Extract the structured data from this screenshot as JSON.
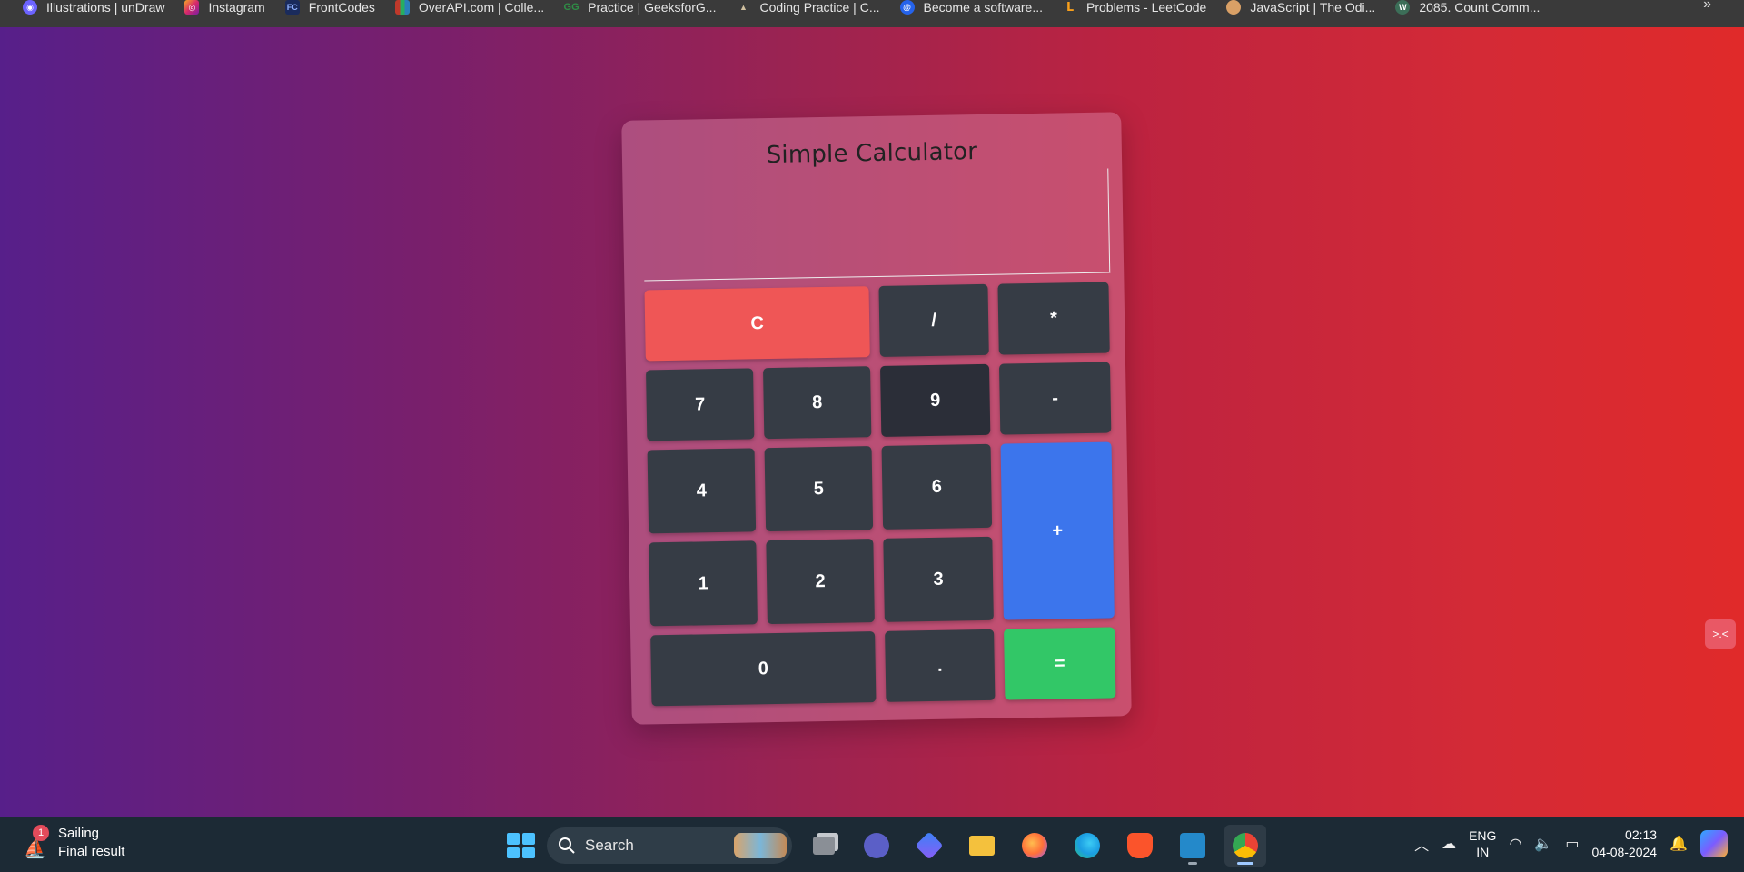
{
  "bookmarks": [
    {
      "label": "Illustrations | unDraw",
      "icon": "undraw-icon",
      "color": "#6c63ff"
    },
    {
      "label": "Instagram",
      "icon": "instagram-icon",
      "color": "#d6286b"
    },
    {
      "label": "FrontCodes",
      "icon": "frontcodes-icon",
      "color": "#1a2b5c"
    },
    {
      "label": "OverAPI.com | Colle...",
      "icon": "overapi-icon",
      "color": "#c0392b"
    },
    {
      "label": "Practice | GeeksforG...",
      "icon": "geeksforgeeks-icon",
      "color": "#2f8d46"
    },
    {
      "label": "Coding Practice | C...",
      "icon": "codechef-icon",
      "color": "#5b4638"
    },
    {
      "label": "Become a software...",
      "icon": "scaler-icon",
      "color": "#2563eb"
    },
    {
      "label": "Problems - LeetCode",
      "icon": "leetcode-icon",
      "color": "#f89f1b"
    },
    {
      "label": "JavaScript | The Odi...",
      "icon": "odin-icon",
      "color": "#d9a066"
    },
    {
      "label": "2085. Count Comm...",
      "icon": "leetcode-w-icon",
      "color": "#3c6e58"
    }
  ],
  "bookmarks_more": "»",
  "calculator": {
    "title": "Simple Calculator",
    "display_value": "",
    "keys": {
      "clear": "C",
      "divide": "/",
      "multiply": "*",
      "seven": "7",
      "eight": "8",
      "nine": "9",
      "minus": "-",
      "four": "4",
      "five": "5",
      "six": "6",
      "plus": "+",
      "one": "1",
      "two": "2",
      "three": "3",
      "zero": "0",
      "dot": ".",
      "equal": "="
    }
  },
  "side_widget": ">.<",
  "taskbar": {
    "weather": {
      "badge": "1",
      "title": "Sailing",
      "subtitle": "Final result"
    },
    "search_label": "Search",
    "tray": {
      "lang_line1": "ENG",
      "lang_line2": "IN",
      "time": "02:13",
      "date": "04-08-2024"
    }
  }
}
